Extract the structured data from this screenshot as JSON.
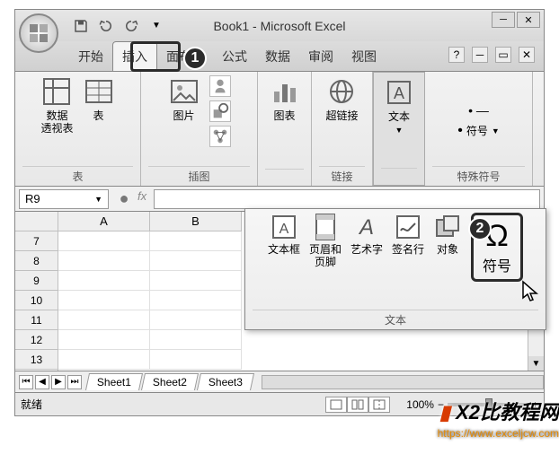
{
  "title": "Book1 - Microsoft Excel",
  "tabs": {
    "t0": "开始",
    "t1": "插入",
    "t2": "面布局",
    "t3": "公式",
    "t4": "数据",
    "t5": "审阅",
    "t6": "视图"
  },
  "markers": {
    "m1": "1",
    "m2": "2"
  },
  "ribbon": {
    "group_table": "表",
    "group_illus": "插图",
    "group_link": "链接",
    "group_special": "特殊符号",
    "btn_pivot": "数据\n透视表",
    "btn_table": "表",
    "btn_picture": "图片",
    "btn_chart": "图表",
    "btn_hyperlink": "超链接",
    "btn_text": "文本",
    "btn_symbol": "符号"
  },
  "popup": {
    "textbox": "文本框",
    "headerfooter": "页眉和\n页脚",
    "wordart": "艺术字",
    "signature": "签名行",
    "object": "对象",
    "symbol": "符号",
    "group_label": "文本"
  },
  "namebox": "R9",
  "cols": {
    "A": "A",
    "B": "B"
  },
  "rows": {
    "r7": "7",
    "r8": "8",
    "r9": "9",
    "r10": "10",
    "r11": "11",
    "r12": "12",
    "r13": "13"
  },
  "sheets": {
    "s1": "Sheet1",
    "s2": "Sheet2",
    "s3": "Sheet3"
  },
  "status": "就绪",
  "zoom": "100%",
  "watermark": {
    "brand": "X2比教程网",
    "url": "https://www.exceljcw.com"
  }
}
